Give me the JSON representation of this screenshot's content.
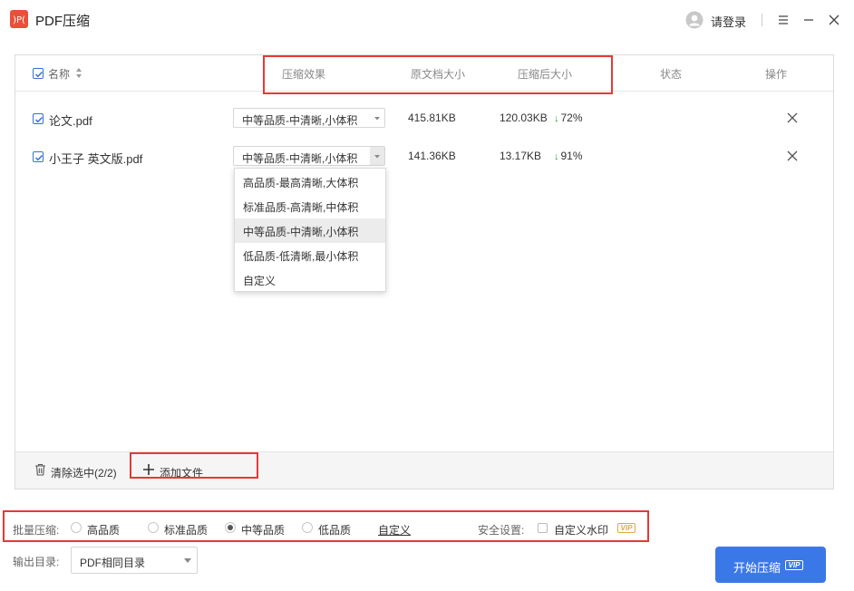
{
  "app": {
    "title": "PDF压缩",
    "login_label": "请登录"
  },
  "header": {
    "name": "名称",
    "effect": "压缩效果",
    "orig_size": "原文档大小",
    "comp_size": "压缩后大小",
    "status": "状态",
    "action": "操作"
  },
  "files": [
    {
      "name": "论文.pdf",
      "quality": "中等品质-中清晰,小体积",
      "orig": "415.81KB",
      "comp": "120.03KB",
      "saved": "72%"
    },
    {
      "name": "小王子 英文版.pdf",
      "quality": "中等品质-中清晰,小体积",
      "orig": "141.36KB",
      "comp": "13.17KB",
      "saved": "91%"
    }
  ],
  "dropdown": {
    "options": [
      "高品质-最高清晰,大体积",
      "标准品质-高清晰,中体积",
      "中等品质-中清晰,小体积",
      "低品质-低清晰,最小体积",
      "自定义"
    ],
    "selected": "中等品质-中清晰,小体积"
  },
  "footer": {
    "clear_label": "清除选中(2/2)",
    "add_label": "添加文件"
  },
  "batch": {
    "label": "批量压缩:",
    "options": [
      "高品质",
      "标准品质",
      "中等品质",
      "低品质"
    ],
    "selected": "中等品质",
    "custom": "自定义"
  },
  "security": {
    "label": "安全设置:",
    "watermark": "自定义水印",
    "vip": "VIP"
  },
  "output": {
    "label": "输出目录:",
    "value": "PDF相同目录"
  },
  "start": {
    "label": "开始压缩",
    "vip": "VIP"
  },
  "colors": {
    "accent": "#3b78e7",
    "annotation": "#e53935",
    "saved_arrow": "#22a745",
    "vip_gold": "#e0a948"
  }
}
